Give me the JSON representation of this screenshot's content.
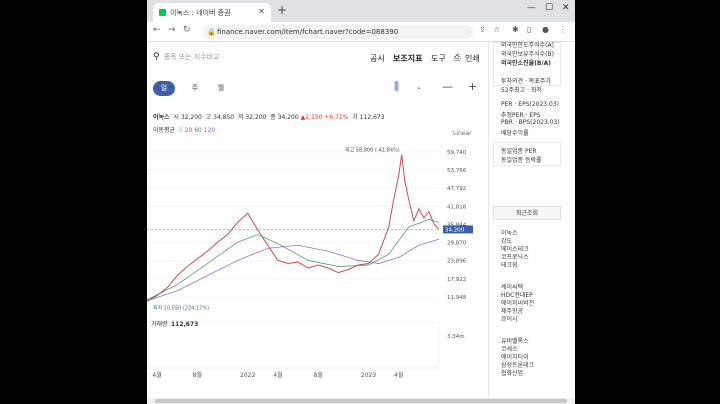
{
  "browser": {
    "tab_title": "이녹스 : 네이버 증권",
    "url": "finance.naver.com/item/fchart.naver?code=088390"
  },
  "toolbar": {
    "search_placeholder": "종목 또는 지수비교",
    "menu": [
      "공시",
      "보조지표",
      "도구",
      "인쇄"
    ]
  },
  "periods": {
    "day": "일",
    "week": "주",
    "month": "월",
    "selected": "일"
  },
  "price_row": {
    "name": "이녹스",
    "open_label": "시",
    "open": "32,200",
    "high_label": "고",
    "high": "34,850",
    "low_label": "저",
    "low": "32,200",
    "close_label": "종",
    "close": "34,200",
    "change": "▲2,150",
    "change_pct": "+6.71%",
    "vol_label": "거",
    "volume": "112,673"
  },
  "ma_row": {
    "label": "이동평균",
    "ma5": "5",
    "ma20": "20",
    "ma60": "60",
    "ma120": "120"
  },
  "scale_label": "Linear",
  "chart_data": {
    "type": "line",
    "title": "",
    "y_ticks": [
      "59,740",
      "53,766",
      "47,792",
      "41,818",
      "35,844",
      "29,870",
      "23,896",
      "17,922",
      "11,948"
    ],
    "y_values": [
      59740,
      53766,
      47792,
      41818,
      35844,
      29870,
      23896,
      17922,
      11948
    ],
    "ylim": [
      9000,
      61000
    ],
    "x_ticks": [
      "4월",
      "8월",
      "2022",
      "4월",
      "8월",
      "2023",
      "4월"
    ],
    "x_tick_months": [
      0,
      4,
      9,
      12,
      16,
      21,
      24
    ],
    "x_range_months": [
      -1,
      28
    ],
    "current_price": "34,200",
    "current_value": 34200,
    "max_annotation": "최고 58,800 (-41.84%)",
    "max_value": 58800,
    "max_month": 24.3,
    "min_annotation": "최저 10,550 (224.17%)",
    "min_value": 10550,
    "min_month": -0.8,
    "series": [
      {
        "x_months": [
          -1,
          0,
          1,
          2,
          3,
          4,
          5,
          6,
          7,
          8,
          9,
          10,
          11,
          12,
          13,
          14,
          15,
          16,
          17,
          18,
          19,
          20,
          21,
          22,
          23,
          23.5,
          24,
          24.3,
          24.6,
          25,
          25.5,
          26,
          26.5,
          27,
          27.5,
          28
        ],
        "values": [
          10550,
          12500,
          15000,
          19000,
          22000,
          24500,
          27000,
          30000,
          32500,
          36500,
          39500,
          34000,
          29000,
          24000,
          23000,
          23500,
          21500,
          22500,
          21500,
          20000,
          21000,
          22500,
          23000,
          26000,
          35000,
          44000,
          52000,
          58800,
          50000,
          44000,
          37000,
          41000,
          38000,
          40000,
          36000,
          34200
        ]
      },
      {
        "name": "120",
        "x_months": [
          -1,
          2,
          5,
          8,
          11,
          14,
          17,
          20,
          22,
          24,
          26,
          28
        ],
        "values": [
          10700,
          14000,
          19000,
          24000,
          28000,
          29000,
          27000,
          24000,
          23000,
          25000,
          29000,
          31000
        ]
      },
      {
        "name": "60",
        "x_months": [
          -1,
          2,
          5,
          8,
          10,
          12,
          15,
          18,
          21,
          23,
          25,
          27,
          28
        ],
        "values": [
          11000,
          16000,
          23000,
          30000,
          32500,
          29500,
          24000,
          22000,
          22500,
          26000,
          35000,
          37500,
          36500
        ]
      }
    ],
    "volume_label": "거래량",
    "volume_value": "112,673",
    "volume_axis_tick": "3.34m",
    "volume_axis_value": 3340000
  },
  "side": {
    "top_items": [
      "외국인한도주식수(A)",
      "외국인보유주식수(B)",
      "외국인소진율(B/A)"
    ],
    "opinion": [
      "투자의견 · 목표주가",
      "52주최고 · 최저"
    ],
    "valuation": [
      "PER · EPS(2023.03)",
      "추정PER · EPS",
      "PBR · BPS(2023.03)",
      "배당수익률"
    ],
    "industry": [
      "동일업종 PER",
      "동일업종 등락률"
    ],
    "recent_title": "최근조회",
    "recent_items": [
      "이녹스",
      "강도",
      "에이스테크",
      "코프로닉스",
      "테크윙",
      "케이씨텍",
      "HDC현대EP",
      "에이치씨비전",
      "제주항공",
      "쿄이시",
      "유비벨록스",
      "코세스",
      "에이치티이",
      "삼성트론테크",
      "협화산업"
    ]
  }
}
